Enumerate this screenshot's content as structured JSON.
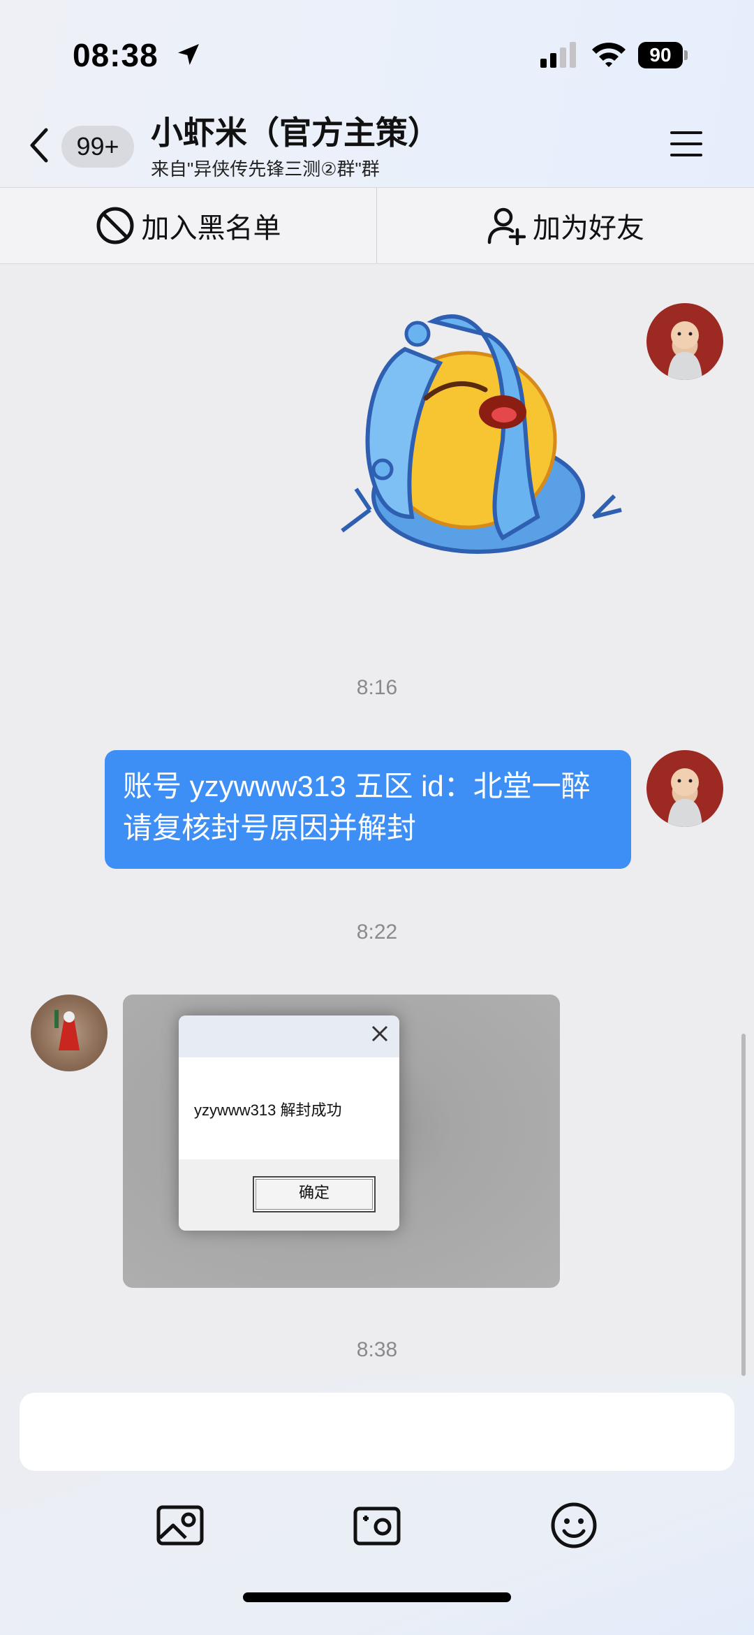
{
  "status_bar": {
    "time": "08:38",
    "battery": "90"
  },
  "header": {
    "unread_count": "99+",
    "title": "小虾米（官方主策）",
    "subtitle": "来自\"异侠传先锋三测②群\"群"
  },
  "actions": {
    "blacklist": "加入黑名单",
    "add_friend": "加为好友"
  },
  "messages": {
    "ts_1": "8:16",
    "outgoing_text": "账号 yzywww313 五区 id：北堂一醉 请复核封号原因并解封",
    "ts_2": "8:22",
    "screenshot_dialog_text": "yzywww313 解封成功",
    "screenshot_dialog_button": "确定",
    "ts_3": "8:38"
  },
  "input": {
    "placeholder": ""
  },
  "colors": {
    "accent": "#3d8ff5",
    "background": "#ededf0"
  }
}
